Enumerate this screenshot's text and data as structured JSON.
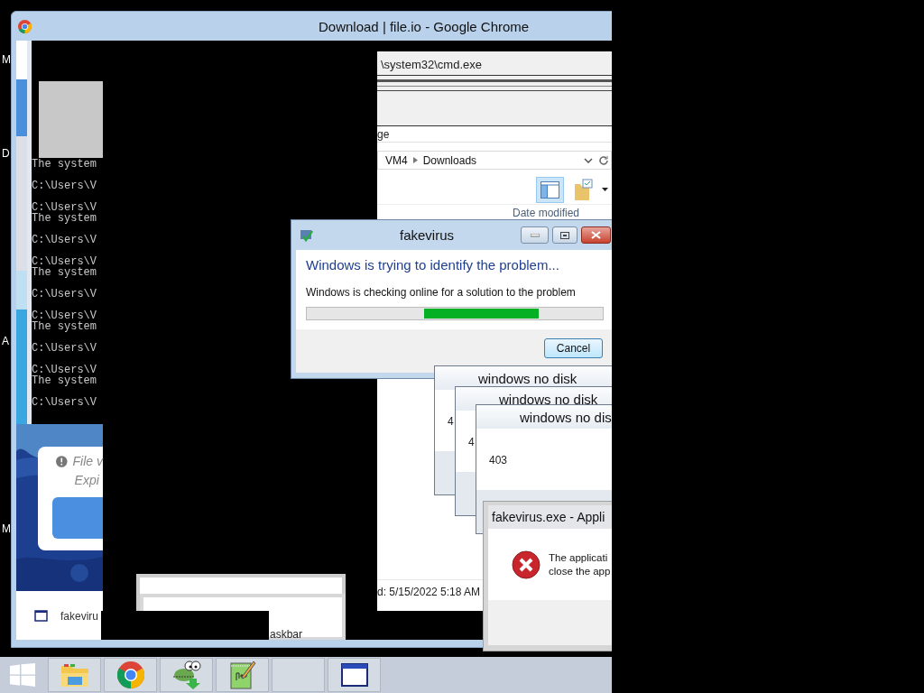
{
  "desktop_icons": [
    {
      "label": "M"
    },
    {
      "label": "D"
    },
    {
      "label": "A"
    },
    {
      "label": "M"
    }
  ],
  "chrome": {
    "title": "Download | file.io - Google Chrome",
    "notice": [
      "File v",
      "Expi"
    ],
    "bottom_item": "fakeviru"
  },
  "console": {
    "groups": [
      [
        "The system"
      ],
      [
        "C:\\Users\\V"
      ],
      [
        "C:\\Users\\V",
        "The system"
      ],
      [
        "C:\\Users\\V"
      ],
      [
        "C:\\Users\\V",
        "The system"
      ],
      [
        "C:\\Users\\V"
      ],
      [
        "C:\\Users\\V",
        "The system"
      ],
      [
        "C:\\Users\\V"
      ],
      [
        "C:\\Users\\V",
        "The system"
      ],
      [
        "C:\\Users\\V"
      ]
    ]
  },
  "explorer": {
    "path_text": "\\system32\\cmd.exe",
    "tab_text": "ge",
    "breadcrumb": [
      "VM4",
      "Downloads"
    ],
    "column_header": "Date modified",
    "status": "d: 5/15/2022 5:18 AM"
  },
  "popup": {
    "text": "askbar"
  },
  "problem_dialog": {
    "title": "fakevirus",
    "heading": "Windows is trying to identify the problem...",
    "message": "Windows is checking online for a solution to the problem",
    "progress": {
      "indeterminate": true
    },
    "button": "Cancel"
  },
  "no_disk_dialogs": [
    {
      "title": "windows no disk",
      "body": "4"
    },
    {
      "title": "windows no disk",
      "body": "4"
    },
    {
      "title": "windows no dis",
      "body": "403"
    }
  ],
  "error_dialog": {
    "title": "fakevirus.exe - Appli",
    "message": [
      "The applicati",
      "close the app"
    ]
  },
  "taskbar": {
    "buttons": [
      {
        "kind": "start"
      },
      {
        "kind": "explorer"
      },
      {
        "kind": "chrome"
      },
      {
        "kind": "lizard"
      },
      {
        "kind": "notepad"
      },
      {
        "kind": "empty"
      },
      {
        "kind": "window"
      }
    ]
  }
}
